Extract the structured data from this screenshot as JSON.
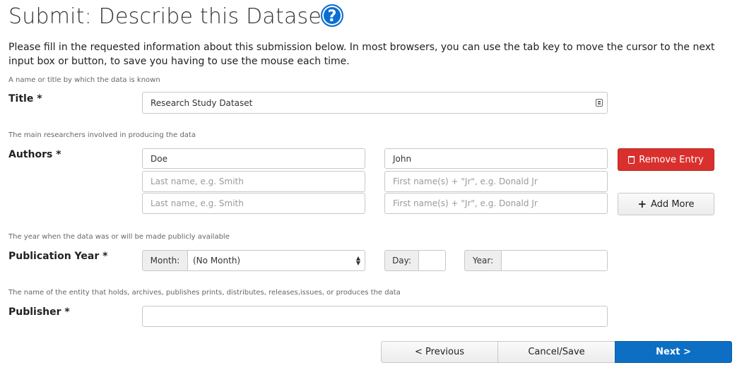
{
  "page": {
    "title": "Submit: Describe this Dataset",
    "help_icon": "question-circle-icon",
    "intro": "Please fill in the requested information about this submission below. In most browsers, you can use the tab key to move the cursor to the next input box or button, to save you having to use the mouse each time."
  },
  "title_field": {
    "hint": "A name or title by which the data is known",
    "label": "Title *",
    "value": "Research Study Dataset"
  },
  "authors": {
    "hint": "The main researchers involved in producing the data",
    "label": "Authors *",
    "rows": [
      {
        "last": "Doe",
        "first": "John"
      },
      {
        "last_placeholder": "Last name, e.g. Smith",
        "first_placeholder": "First name(s) + \"Jr\", e.g. Donald Jr"
      },
      {
        "last_placeholder": "Last name, e.g. Smith",
        "first_placeholder": "First name(s) + \"Jr\", e.g. Donald Jr"
      }
    ],
    "remove_label": "Remove Entry",
    "add_label": "Add More"
  },
  "pubyear": {
    "hint": "The year when the data was or will be made publicly available",
    "label": "Publication Year *",
    "month_label": "Month:",
    "month_value": "(No Month)",
    "day_label": "Day:",
    "year_label": "Year:"
  },
  "publisher": {
    "hint": "The name of the entity that holds, archives, publishes prints, distributes, releases,issues, or produces the data",
    "label": "Publisher *"
  },
  "nav": {
    "previous": "< Previous",
    "cancel": "Cancel/Save",
    "next": "Next >"
  },
  "colors": {
    "primary": "#0d6fc4",
    "danger": "#d9302e"
  }
}
